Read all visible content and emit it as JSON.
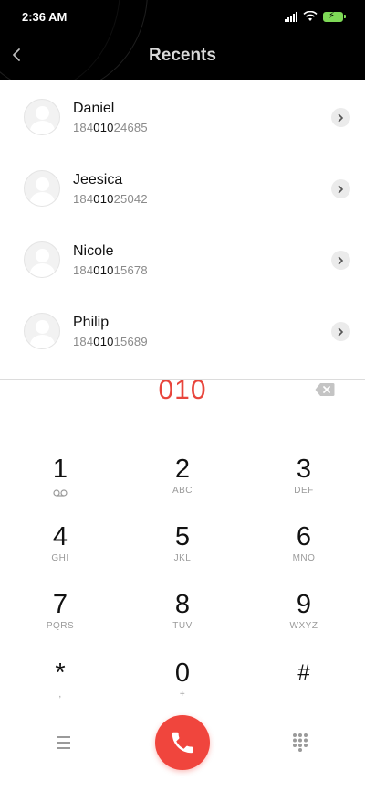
{
  "status_bar": {
    "time": "2:36 AM"
  },
  "header": {
    "title": "Recents"
  },
  "contacts": [
    {
      "name": "Daniel",
      "number_prefix": "184",
      "number_match": "010",
      "number_suffix": "24685"
    },
    {
      "name": "Jeesica",
      "number_prefix": "184",
      "number_match": "010",
      "number_suffix": "25042"
    },
    {
      "name": "Nicole",
      "number_prefix": "184",
      "number_match": "010",
      "number_suffix": "15678"
    },
    {
      "name": "Philip",
      "number_prefix": "184",
      "number_match": "010",
      "number_suffix": "15689"
    }
  ],
  "dialer": {
    "input_value": "010"
  },
  "keypad": [
    {
      "digit": "1",
      "letters": ""
    },
    {
      "digit": "2",
      "letters": "ABC"
    },
    {
      "digit": "3",
      "letters": "DEF"
    },
    {
      "digit": "4",
      "letters": "GHI"
    },
    {
      "digit": "5",
      "letters": "JKL"
    },
    {
      "digit": "6",
      "letters": "MNO"
    },
    {
      "digit": "7",
      "letters": "PQRS"
    },
    {
      "digit": "8",
      "letters": "TUV"
    },
    {
      "digit": "9",
      "letters": "WXYZ"
    },
    {
      "digit": "*",
      "letters": ","
    },
    {
      "digit": "0",
      "letters": "+"
    },
    {
      "digit": "#",
      "letters": ""
    }
  ],
  "icons": {
    "back": "chevron-left-icon",
    "detail": "chevron-right-icon",
    "backspace": "backspace-icon",
    "voicemail": "voicemail-icon",
    "menu": "menu-icon",
    "call": "phone-icon",
    "dialpad": "dialpad-icon"
  },
  "colors": {
    "accent": "#e8453c",
    "call_button": "#f0453d",
    "header_bg": "#000000",
    "battery": "#7ed957"
  }
}
